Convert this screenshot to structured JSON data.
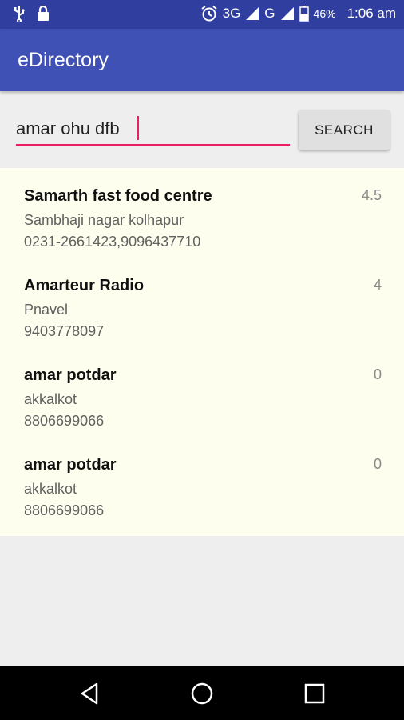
{
  "status_bar": {
    "network": "3G",
    "network2": "G",
    "battery": "46%",
    "time": "1:06 am"
  },
  "app": {
    "title": "eDirectory"
  },
  "search": {
    "value": "amar ohu dfb",
    "button_label": "SEARCH"
  },
  "results": [
    {
      "name": "Samarth fast food centre",
      "address": "Sambhaji nagar kolhapur",
      "phone": "0231-2661423,9096437710",
      "rating": "4.5"
    },
    {
      "name": "Amarteur Radio",
      "address": "Pnavel",
      "phone": "9403778097",
      "rating": "4"
    },
    {
      "name": "amar potdar",
      "address": "akkalkot",
      "phone": "8806699066",
      "rating": "0"
    },
    {
      "name": "amar potdar",
      "address": "akkalkot",
      "phone": "8806699066",
      "rating": "0"
    }
  ],
  "colors": {
    "status_bar": "#303F9F",
    "app_bar": "#3F51B5",
    "accent": "#E91E63",
    "list_bg": "#fefeee"
  }
}
